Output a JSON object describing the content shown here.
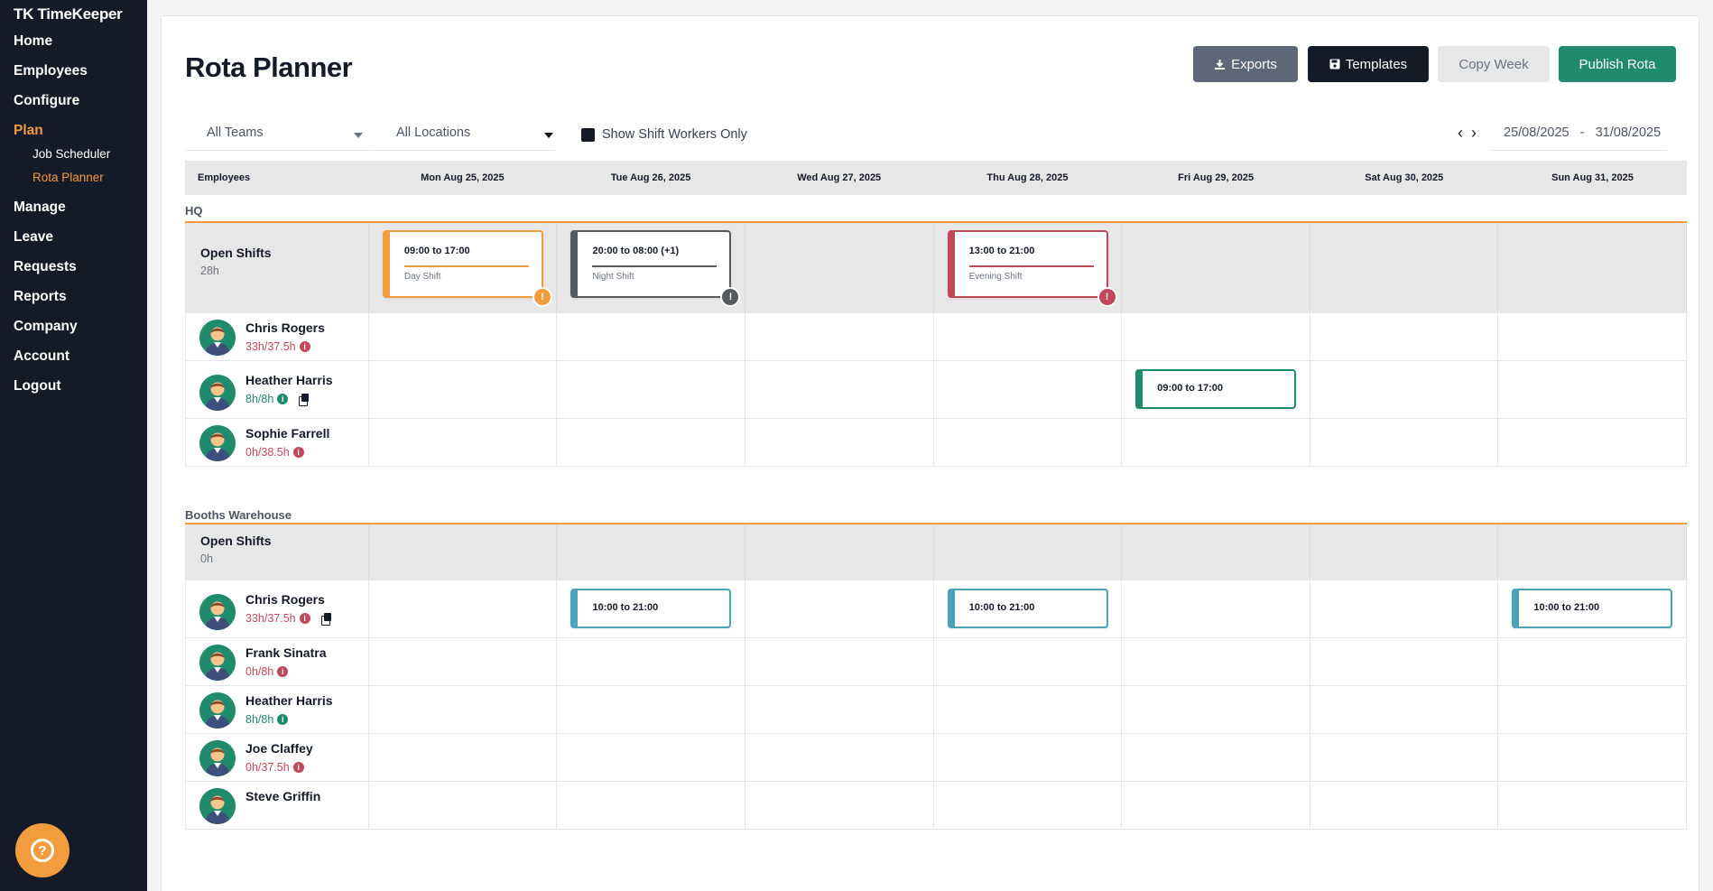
{
  "app": {
    "brand": "TK TimeKeeper"
  },
  "sidebar": {
    "items": [
      {
        "label": "Home"
      },
      {
        "label": "Employees"
      },
      {
        "label": "Configure"
      },
      {
        "label": "Plan",
        "active": true
      },
      {
        "label": "Manage"
      },
      {
        "label": "Leave"
      },
      {
        "label": "Requests"
      },
      {
        "label": "Reports"
      },
      {
        "label": "Company"
      },
      {
        "label": "Account"
      },
      {
        "label": "Logout"
      }
    ],
    "plan_subitems": [
      {
        "label": "Job Scheduler"
      },
      {
        "label": "Rota Planner",
        "active": true
      }
    ],
    "help_label": "?"
  },
  "page": {
    "title": "Rota Planner"
  },
  "toolbar": {
    "exports_label": "Exports",
    "templates_label": "Templates",
    "copy_week_label": "Copy Week",
    "publish_label": "Publish Rota"
  },
  "filters": {
    "teams": "All Teams",
    "locations": "All Locations",
    "shift_workers_only": "Show Shift Workers Only",
    "date_from": "25/08/2025",
    "date_separator": "-",
    "date_to": "31/08/2025"
  },
  "grid": {
    "employees_header": "Employees",
    "days": [
      "Mon Aug 25, 2025",
      "Tue Aug 26, 2025",
      "Wed Aug 27, 2025",
      "Thu Aug 28, 2025",
      "Fri Aug 29, 2025",
      "Sat Aug 30, 2025",
      "Sun Aug 31, 2025"
    ],
    "groups": [
      {
        "name": "HQ",
        "open_shifts": {
          "label": "Open Shifts",
          "hours": "28h"
        },
        "open_shift_cards": [
          {
            "day": 0,
            "time": "09:00 to 17:00",
            "name": "Day Shift",
            "color": "#f39c3d",
            "warn": "!"
          },
          {
            "day": 1,
            "time": "20:00 to 08:00 (+1)",
            "name": "Night Shift",
            "color": "#555a5f",
            "warn": "!"
          },
          {
            "day": 3,
            "time": "13:00 to 21:00",
            "name": "Evening Shift",
            "color": "#c0485a",
            "warn": "!"
          }
        ],
        "employees": [
          {
            "name": "Chris Rogers",
            "hours": "33h/37.5h",
            "status": "red",
            "shifts": []
          },
          {
            "name": "Heather Harris",
            "hours": "8h/8h",
            "status": "green",
            "copy": true,
            "shifts": [
              {
                "day": 4,
                "time": "09:00 to 17:00",
                "color": "#1f8a6c"
              }
            ]
          },
          {
            "name": "Sophie Farrell",
            "hours": "0h/38.5h",
            "status": "red",
            "shifts": []
          }
        ]
      },
      {
        "name": "Booths Warehouse",
        "open_shifts": {
          "label": "Open Shifts",
          "hours": "0h"
        },
        "open_shift_cards": [],
        "employees": [
          {
            "name": "Chris Rogers",
            "hours": "33h/37.5h",
            "status": "red",
            "copy": true,
            "shifts": [
              {
                "day": 1,
                "time": "10:00 to 21:00",
                "color": "#4aa3b8"
              },
              {
                "day": 3,
                "time": "10:00 to 21:00",
                "color": "#4aa3b8"
              },
              {
                "day": 6,
                "time": "10:00 to 21:00",
                "color": "#4aa3b8"
              }
            ]
          },
          {
            "name": "Frank Sinatra",
            "hours": "0h/8h",
            "status": "red",
            "shifts": []
          },
          {
            "name": "Heather Harris",
            "hours": "8h/8h",
            "status": "green",
            "shifts": []
          },
          {
            "name": "Joe Claffey",
            "hours": "0h/37.5h",
            "status": "red",
            "shifts": []
          },
          {
            "name": "Steve Griffin",
            "hours": "",
            "status": "red",
            "shifts": []
          }
        ]
      }
    ]
  },
  "colors": {
    "accent": "#f39c3d",
    "sidebar_bg": "#151a28",
    "publish": "#1f8a6c"
  }
}
